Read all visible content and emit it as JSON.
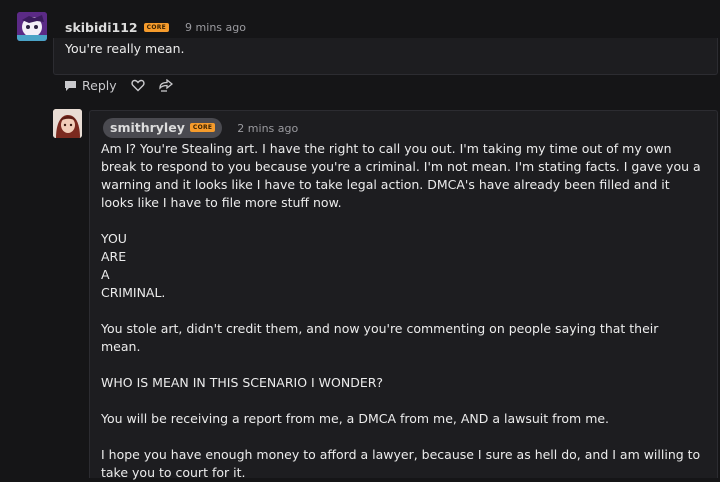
{
  "comment1": {
    "username": "skibidi112",
    "badge": "CORE",
    "timestamp": "9 mins ago",
    "text": "You're really mean.",
    "actions": {
      "reply_label": "Reply"
    }
  },
  "comment2": {
    "username": "smithryley",
    "badge": "CORE",
    "timestamp": "2 mins ago",
    "paragraphs": [
      "Am I? You're Stealing art. I have the right to call you out. I'm taking my time out of my own break to respond to you because you're a criminal. I'm not mean. I'm stating facts. I gave you a warning and it looks like I have to take legal action. DMCA's have already been filled and it looks like I have to file more stuff now.",
      "YOU",
      "ARE",
      "A",
      "CRIMINAL.",
      "You stole art, didn't credit them, and now you're commenting on people saying that their mean.",
      "WHO IS MEAN IN THIS SCENARIO I WONDER?",
      "You will be receiving a report from me, a DMCA from me, AND a lawsuit from me.",
      "I hope you have enough money to afford a lawyer, because I sure as hell do, and I am willing to take you to court for it."
    ]
  },
  "colors": {
    "background": "#151517",
    "card": "#1d1d20",
    "badge": "#f59b2c"
  }
}
